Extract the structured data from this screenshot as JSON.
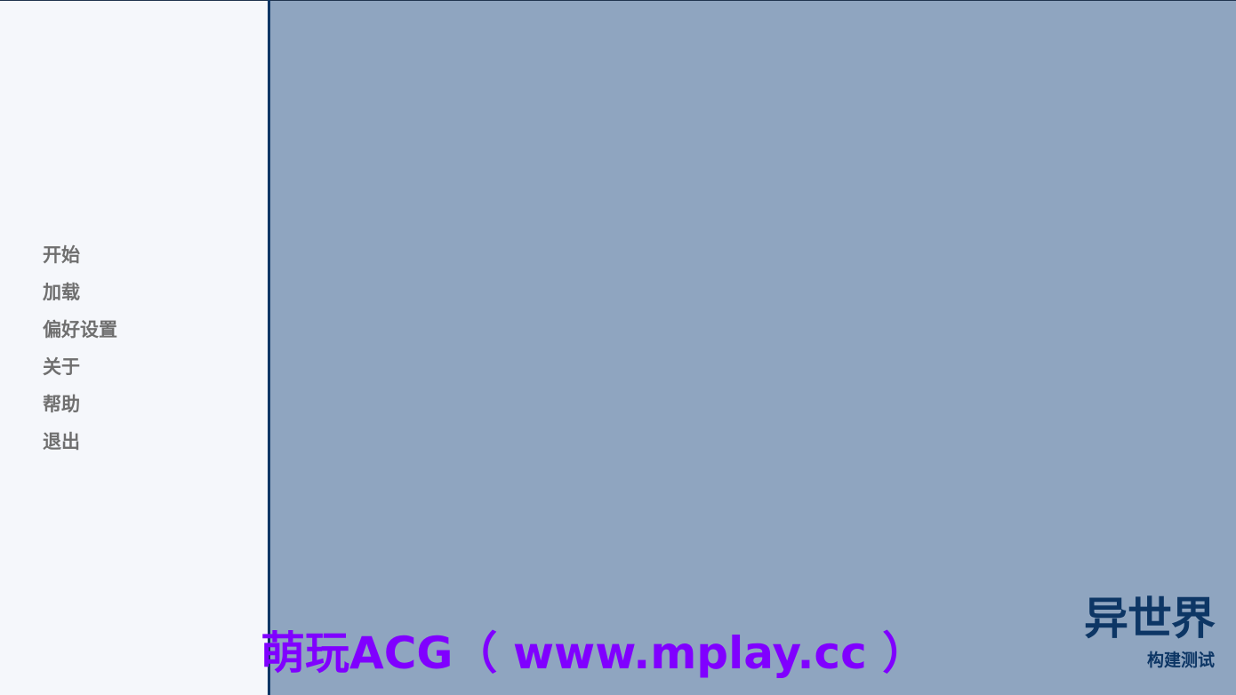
{
  "menu": {
    "items": [
      {
        "label": "开始"
      },
      {
        "label": "加载"
      },
      {
        "label": "偏好设置"
      },
      {
        "label": "关于"
      },
      {
        "label": "帮助"
      },
      {
        "label": "退出"
      }
    ]
  },
  "watermark": {
    "text": "萌玩ACG（ www.mplay.cc ）"
  },
  "logo": {
    "title": "异世界",
    "subtitle": "构建测试"
  },
  "colors": {
    "background": "#8fa5c0",
    "sidebar": "#f5f7fb",
    "accent": "#0d3665",
    "menu_text": "#6f6f6f",
    "watermark": "#8000ff"
  }
}
